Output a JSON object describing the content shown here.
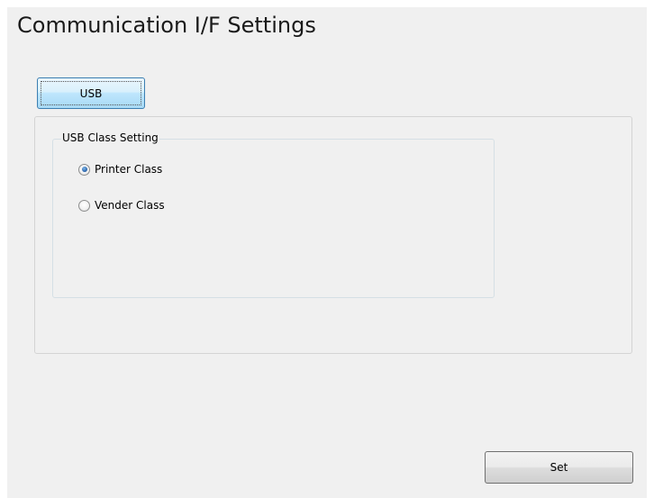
{
  "header": {
    "title": "Communication I/F Settings"
  },
  "tabs": [
    {
      "label": "USB",
      "selected": true
    }
  ],
  "usb_class_group": {
    "legend": "USB Class Setting",
    "options": [
      {
        "label": "Printer Class",
        "checked": true
      },
      {
        "label": "Vender Class",
        "checked": false
      }
    ]
  },
  "actions": {
    "set_label": "Set"
  },
  "colors": {
    "tab_border": "#3c7fb1",
    "tab_fill": "#bee6fd",
    "background": "#f0f0f0"
  }
}
